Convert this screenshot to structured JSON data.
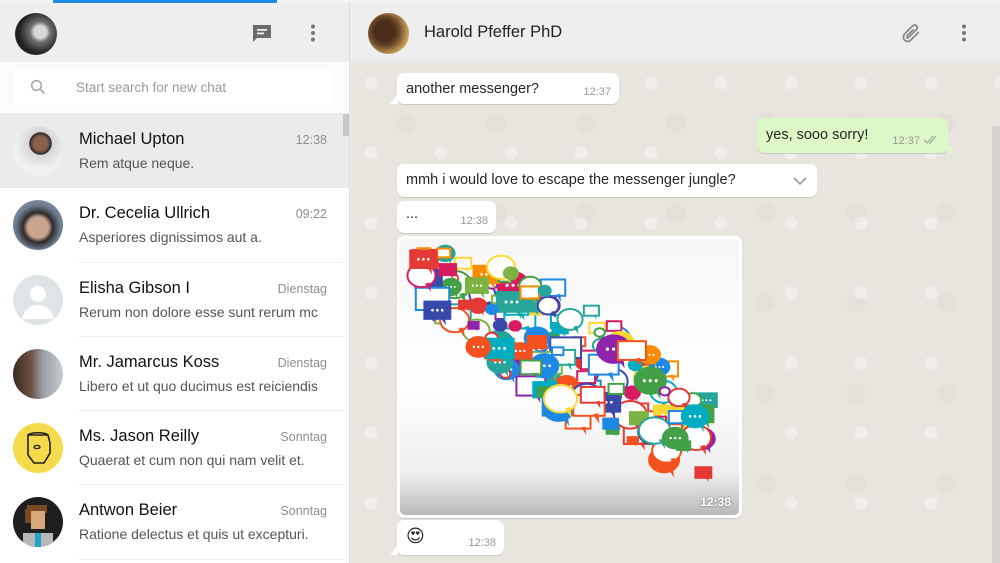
{
  "topbar": {
    "active_tab_color": "#1e88e5"
  },
  "sidebar": {
    "header": {
      "avatar": "user-profile-photo",
      "new_chat_icon": "chat-bubble-icon",
      "menu_icon": "more-vertical-icon"
    },
    "search": {
      "placeholder": "Start search for new chat",
      "value": ""
    },
    "chats": [
      {
        "name": "Michael Upton",
        "time": "12:38",
        "preview": "Rem atque neque.",
        "active": true,
        "avatar": "bearded-man-glasses"
      },
      {
        "name": "Dr. Cecelia Ullrich",
        "time": "09:22",
        "preview": "Asperiores dignissimos aut a.",
        "active": false,
        "avatar": "young-man-photo"
      },
      {
        "name": "Elisha Gibson I",
        "time": "Dienstag",
        "preview": "Rerum non dolore esse sunt rerum mc",
        "active": false,
        "avatar": "default-person-placeholder"
      },
      {
        "name": "Mr. Jamarcus Koss",
        "time": "Dienstag",
        "preview": "Libero et ut quo ducimus est reiciendis",
        "active": false,
        "avatar": "man-cityscape-photo"
      },
      {
        "name": "Ms. Jason Reilly",
        "time": "Sonntag",
        "preview": "Quaerat et cum non qui nam velit et.",
        "active": false,
        "avatar": "yellow-robot-illustration"
      },
      {
        "name": "Antwon Beier",
        "time": "Sonntag",
        "preview": "Ratione delectus et quis ut excepturi.",
        "active": false,
        "avatar": "pixel-art-person"
      }
    ]
  },
  "conversation": {
    "contact_name": "Harold Pfeffer PhD",
    "attach_icon": "paperclip-icon",
    "menu_icon": "more-vertical-icon",
    "messages": [
      {
        "direction": "in",
        "text": "another messenger?",
        "time": "12:37"
      },
      {
        "direction": "out",
        "text": "yes, sooo sorry!",
        "time": "12:37",
        "status": "read-double-check"
      },
      {
        "direction": "in",
        "text": "mmh i would love to escape the messenger jungle?",
        "time": "",
        "has_menu_chevron": true
      },
      {
        "direction": "in",
        "text": "...",
        "time": "12:38"
      },
      {
        "direction": "in",
        "type": "image",
        "image": "colorful-speech-bubbles-collage",
        "time": "12:38"
      },
      {
        "direction": "in",
        "text": "😍",
        "time": "12:38"
      }
    ]
  }
}
